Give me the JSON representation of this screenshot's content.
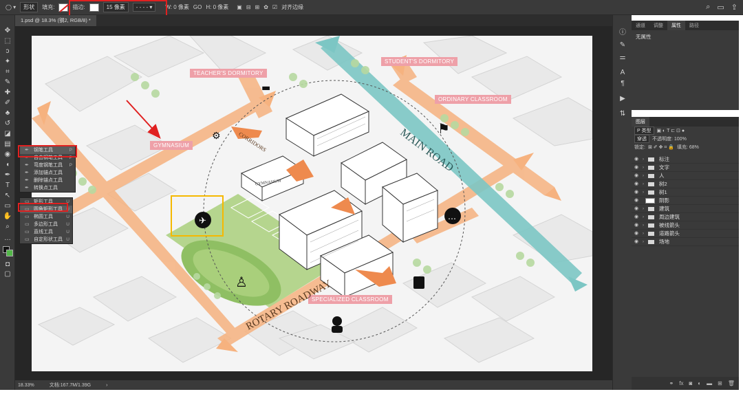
{
  "options_bar": {
    "shape_mode": "形状",
    "fill_label": "填充:",
    "stroke_label": "描边:",
    "stroke_width": "15 像素",
    "w_label": "W: 0 像素",
    "link_label": "GO",
    "h_label": "H: 0 像素",
    "align_edges_label": "对齐边缘",
    "accent_red": "#e02020"
  },
  "document": {
    "tab_label": "1.psd @ 18.3% (钢2, RGB/8) *",
    "zoom": "18.33%",
    "doc_size": "文档:167.7M/1.39G"
  },
  "flyout_pen": {
    "items": [
      {
        "label": "钢笔工具",
        "key": "P",
        "selected": true
      },
      {
        "label": "自由钢笔工具",
        "key": "P",
        "selected": false
      },
      {
        "label": "弯度钢笔工具",
        "key": "P",
        "selected": false
      },
      {
        "label": "添加锚点工具",
        "key": "",
        "selected": false
      },
      {
        "label": "删除锚点工具",
        "key": "",
        "selected": false
      },
      {
        "label": "转换点工具",
        "key": "",
        "selected": false
      }
    ]
  },
  "flyout_shape": {
    "items": [
      {
        "label": "矩形工具",
        "key": "U",
        "selected": false
      },
      {
        "label": "圆角矩形工具",
        "key": "U",
        "selected": true
      },
      {
        "label": "椭圆工具",
        "key": "U",
        "selected": false
      },
      {
        "label": "多边形工具",
        "key": "U",
        "selected": false
      },
      {
        "label": "直线工具",
        "key": "U",
        "selected": false
      },
      {
        "label": "自定形状工具",
        "key": "U",
        "selected": false
      }
    ]
  },
  "scene": {
    "labels": {
      "teacher": "TEACHER'S DORMITORY",
      "student": "STUDENT'S DORMITORY",
      "ordinary": "ORDINARY CLASSROOM",
      "gym": "GYMNASIUM",
      "specialized": "SPECIALIZED CLASSROOM",
      "corridors": "CORRIDORS",
      "gymnasium_small": "GYMNASIUM"
    },
    "roads": {
      "main": "MAIN ROAD",
      "rotary": "ROTARY ROADWAY"
    },
    "colors": {
      "label_bg": "#eea0a8",
      "orange_road": "#f6b27f",
      "orange_arrow": "#ee8a4e",
      "teal_road": "#7cc6c4",
      "green_field": "#a9cf7b",
      "highlight_yellow": "#f5b800"
    }
  },
  "properties_panel": {
    "tabs": [
      "通道",
      "调整",
      "属性",
      "路径"
    ],
    "active_tab": "属性",
    "body": "无属性"
  },
  "layers_panel": {
    "tab": "图层",
    "filter": "P 类型",
    "blend": "穿透",
    "opacity_label": "不透明度: 100%",
    "lock_label": "锁定:",
    "fill_label": "填充: 68%",
    "rows": [
      {
        "label": "标注",
        "kind": "folder"
      },
      {
        "label": "文字",
        "kind": "folder"
      },
      {
        "label": "人",
        "kind": "folder"
      },
      {
        "label": "树2",
        "kind": "folder"
      },
      {
        "label": "树1",
        "kind": "folder"
      },
      {
        "label": "阴影",
        "kind": "layer"
      },
      {
        "label": "建筑",
        "kind": "folder"
      },
      {
        "label": "周边建筑",
        "kind": "folder"
      },
      {
        "label": "被线箭头",
        "kind": "folder"
      },
      {
        "label": "道路箭头",
        "kind": "folder"
      },
      {
        "label": "场地",
        "kind": "folder"
      }
    ]
  }
}
